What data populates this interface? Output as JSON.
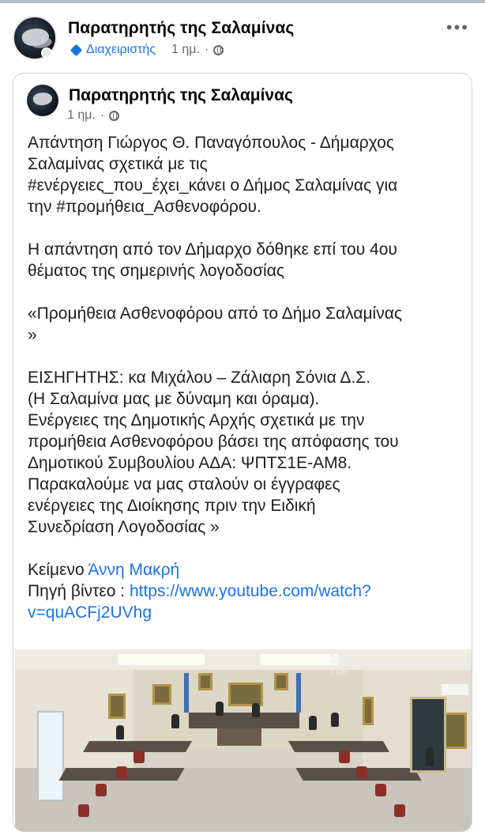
{
  "outer_post": {
    "author": "Παρατηρητής της Σαλαμίνας",
    "role": "Διαχειριστής",
    "time": "1 ημ.",
    "separator": "·",
    "more_icon": "more-horizontal-icon"
  },
  "shared_post": {
    "author": "Παρατηρητής της Σαλαμίνας",
    "time": "1 ημ.",
    "separator": "·",
    "text": {
      "p1_l1": "Απάντηση Γιώργος Θ. Παναγόπουλος - Δήμαρχος",
      "p1_l2": "Σαλαμίνας σχετικά με τις",
      "p1_l3": "#ενέργειες_που_έχει_κάνει ο Δήμος Σαλαμίνας για",
      "p1_l4": "την #προμήθεια_Ασθενοφόρου.",
      "p2_l1": "Η απάντηση από τον Δήμαρχο δόθηκε επί του 4ου",
      "p2_l2": "θέματος της  σημερινής λογοδοσίας",
      "p3_l1": "«Προμήθεια Ασθενοφόρου από το Δήμο Σαλαμίνας",
      "p3_l2": "»",
      "p4_l1": "ΕΙΣΗΓΗΤΗΣ: κα Μιχάλου – Ζάλιαρη Σόνια Δ.Σ.",
      "p4_l2": "(Η Σαλαμίνα μας με δύναμη και όραμα).",
      "p4_l3": "Ενέργειες της Δημοτικής Αρχής σχετικά με την",
      "p4_l4": "προμήθεια Ασθενοφόρου βάσει της απόφασης του",
      "p4_l5": "Δημοτικού Συμβουλίου ΑΔΑ: ΨΠΤΣ1Ε-ΑΜ8.",
      "p4_l6": "Παρακαλούμε να μας σταλούν οι έγγραφες",
      "p4_l7": "ενέργειες της Διοίκησης πριν την Ειδική",
      "p4_l8": "Συνεδρίαση Λογοδοσίας »",
      "text_label": "Κείμενο ",
      "text_author": "Άννη Μακρή",
      "source_label": "Πηγή βίντεο : ",
      "source_link_l1": "https://www.youtube.com/watch?",
      "source_link_l2": "v=quACFj2UVhg"
    },
    "video": {
      "timestamp": "2020-02-24 19:42:57 Tue"
    }
  },
  "colors": {
    "link": "#1b74e4",
    "meta": "#65676b",
    "text": "#1c1e21"
  }
}
